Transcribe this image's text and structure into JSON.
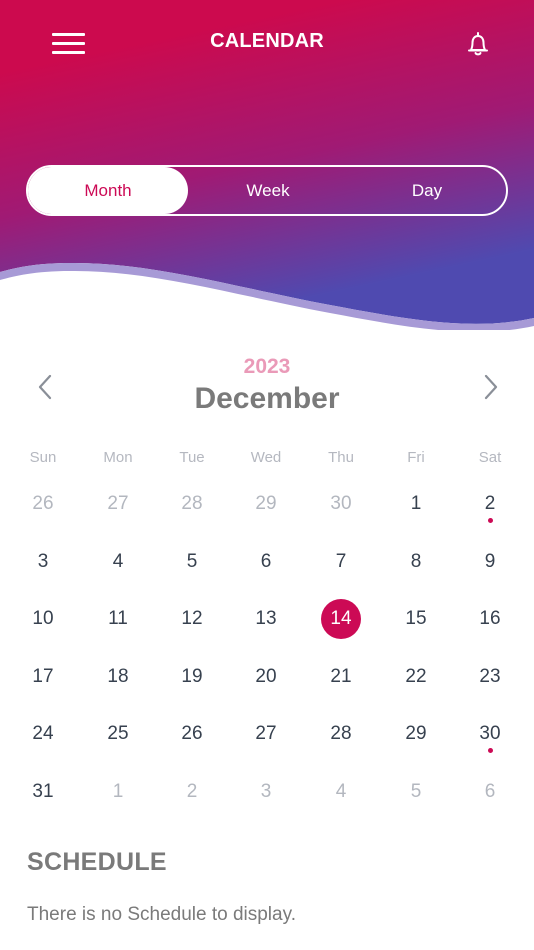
{
  "header": {
    "title": "CALENDAR",
    "menu_icon": "hamburger-menu-icon",
    "bell_icon": "bell-icon",
    "gradient_colors": [
      "#cc0a4e",
      "#a01a74",
      "#4f4ab0"
    ]
  },
  "view_toggle": {
    "options": [
      "Month",
      "Week",
      "Day"
    ],
    "selected": "Month"
  },
  "calendar": {
    "year": "2023",
    "month": "December",
    "prev_icon": "chevron-left-icon",
    "next_icon": "chevron-right-icon",
    "weekdays": [
      "Sun",
      "Mon",
      "Tue",
      "Wed",
      "Thu",
      "Fri",
      "Sat"
    ],
    "weeks": [
      [
        "26",
        "27",
        "28",
        "29",
        "30",
        "1",
        "2"
      ],
      [
        "3",
        "4",
        "5",
        "6",
        "7",
        "8",
        "9"
      ],
      [
        "10",
        "11",
        "12",
        "13",
        "14",
        "15",
        "16"
      ],
      [
        "17",
        "18",
        "19",
        "20",
        "21",
        "22",
        "23"
      ],
      [
        "24",
        "25",
        "26",
        "27",
        "28",
        "29",
        "30"
      ],
      [
        "31",
        "1",
        "2",
        "3",
        "4",
        "5",
        "6"
      ]
    ],
    "other_month_days": [
      "26",
      "27",
      "28",
      "29",
      "30"
    ],
    "selected_day": "14",
    "event_days": [
      "2",
      "30"
    ],
    "accent_color": "#cc0a55"
  },
  "schedule": {
    "title": "SCHEDULE",
    "empty_text": "There is no Schedule to display."
  }
}
